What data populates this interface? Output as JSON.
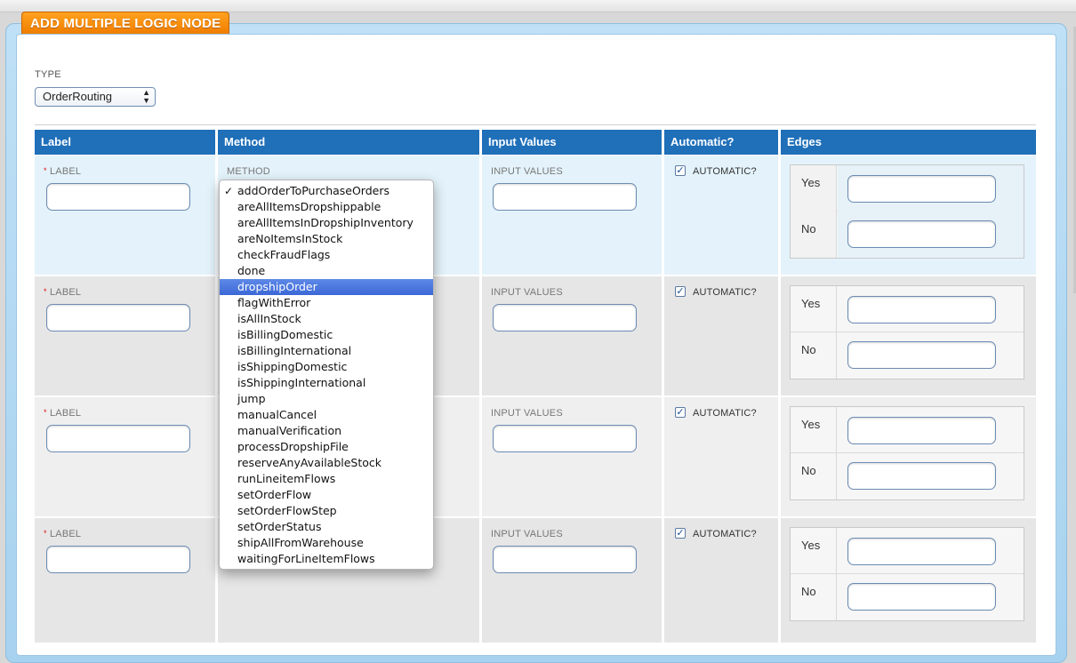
{
  "panel": {
    "title": "ADD MULTIPLE LOGIC NODE"
  },
  "type_field": {
    "label": "TYPE",
    "value": "OrderRouting",
    "arrows": "▲\n▼"
  },
  "table": {
    "headers": [
      "Label",
      "Method",
      "Input Values",
      "Automatic?",
      "Edges"
    ],
    "field_labels": {
      "label": "LABEL",
      "required_mark": "*",
      "method": "METHOD",
      "input_values": "INPUT VALUES",
      "automatic": "AUTOMATIC?"
    },
    "rows": [
      {
        "automatic_checked": true,
        "edges": [
          {
            "name": "Yes",
            "value": ""
          },
          {
            "name": "No",
            "value": ""
          }
        ]
      },
      {
        "automatic_checked": true,
        "edges": [
          {
            "name": "Yes",
            "value": ""
          },
          {
            "name": "No",
            "value": ""
          }
        ]
      },
      {
        "automatic_checked": true,
        "edges": [
          {
            "name": "Yes",
            "value": ""
          },
          {
            "name": "No",
            "value": ""
          }
        ]
      },
      {
        "automatic_checked": true,
        "edges": [
          {
            "name": "Yes",
            "value": ""
          },
          {
            "name": "No",
            "value": ""
          }
        ]
      }
    ]
  },
  "method_menu": {
    "checked_item": "addOrderToPurchaseOrders",
    "highlighted_item": "dropshipOrder",
    "check_glyph": "✓",
    "items": [
      "addOrderToPurchaseOrders",
      "areAllItemsDropshippable",
      "areAllItemsInDropshipInventory",
      "areNoItemsInStock",
      "checkFraudFlags",
      "done",
      "dropshipOrder",
      "flagWithError",
      "isAllInStock",
      "isBillingDomestic",
      "isBillingInternational",
      "isShippingDomestic",
      "isShippingInternational",
      "jump",
      "manualCancel",
      "manualVerification",
      "processDropshipFile",
      "reserveAnyAvailableStock",
      "runLineitemFlows",
      "setOrderFlow",
      "setOrderFlowStep",
      "setOrderStatus",
      "shipAllFromWarehouse",
      "waitingForLineItemFlows"
    ]
  },
  "colors": {
    "header_blue": "#1f6fb9",
    "tab_orange": "#f07d00",
    "highlight": "#3b68d6"
  }
}
